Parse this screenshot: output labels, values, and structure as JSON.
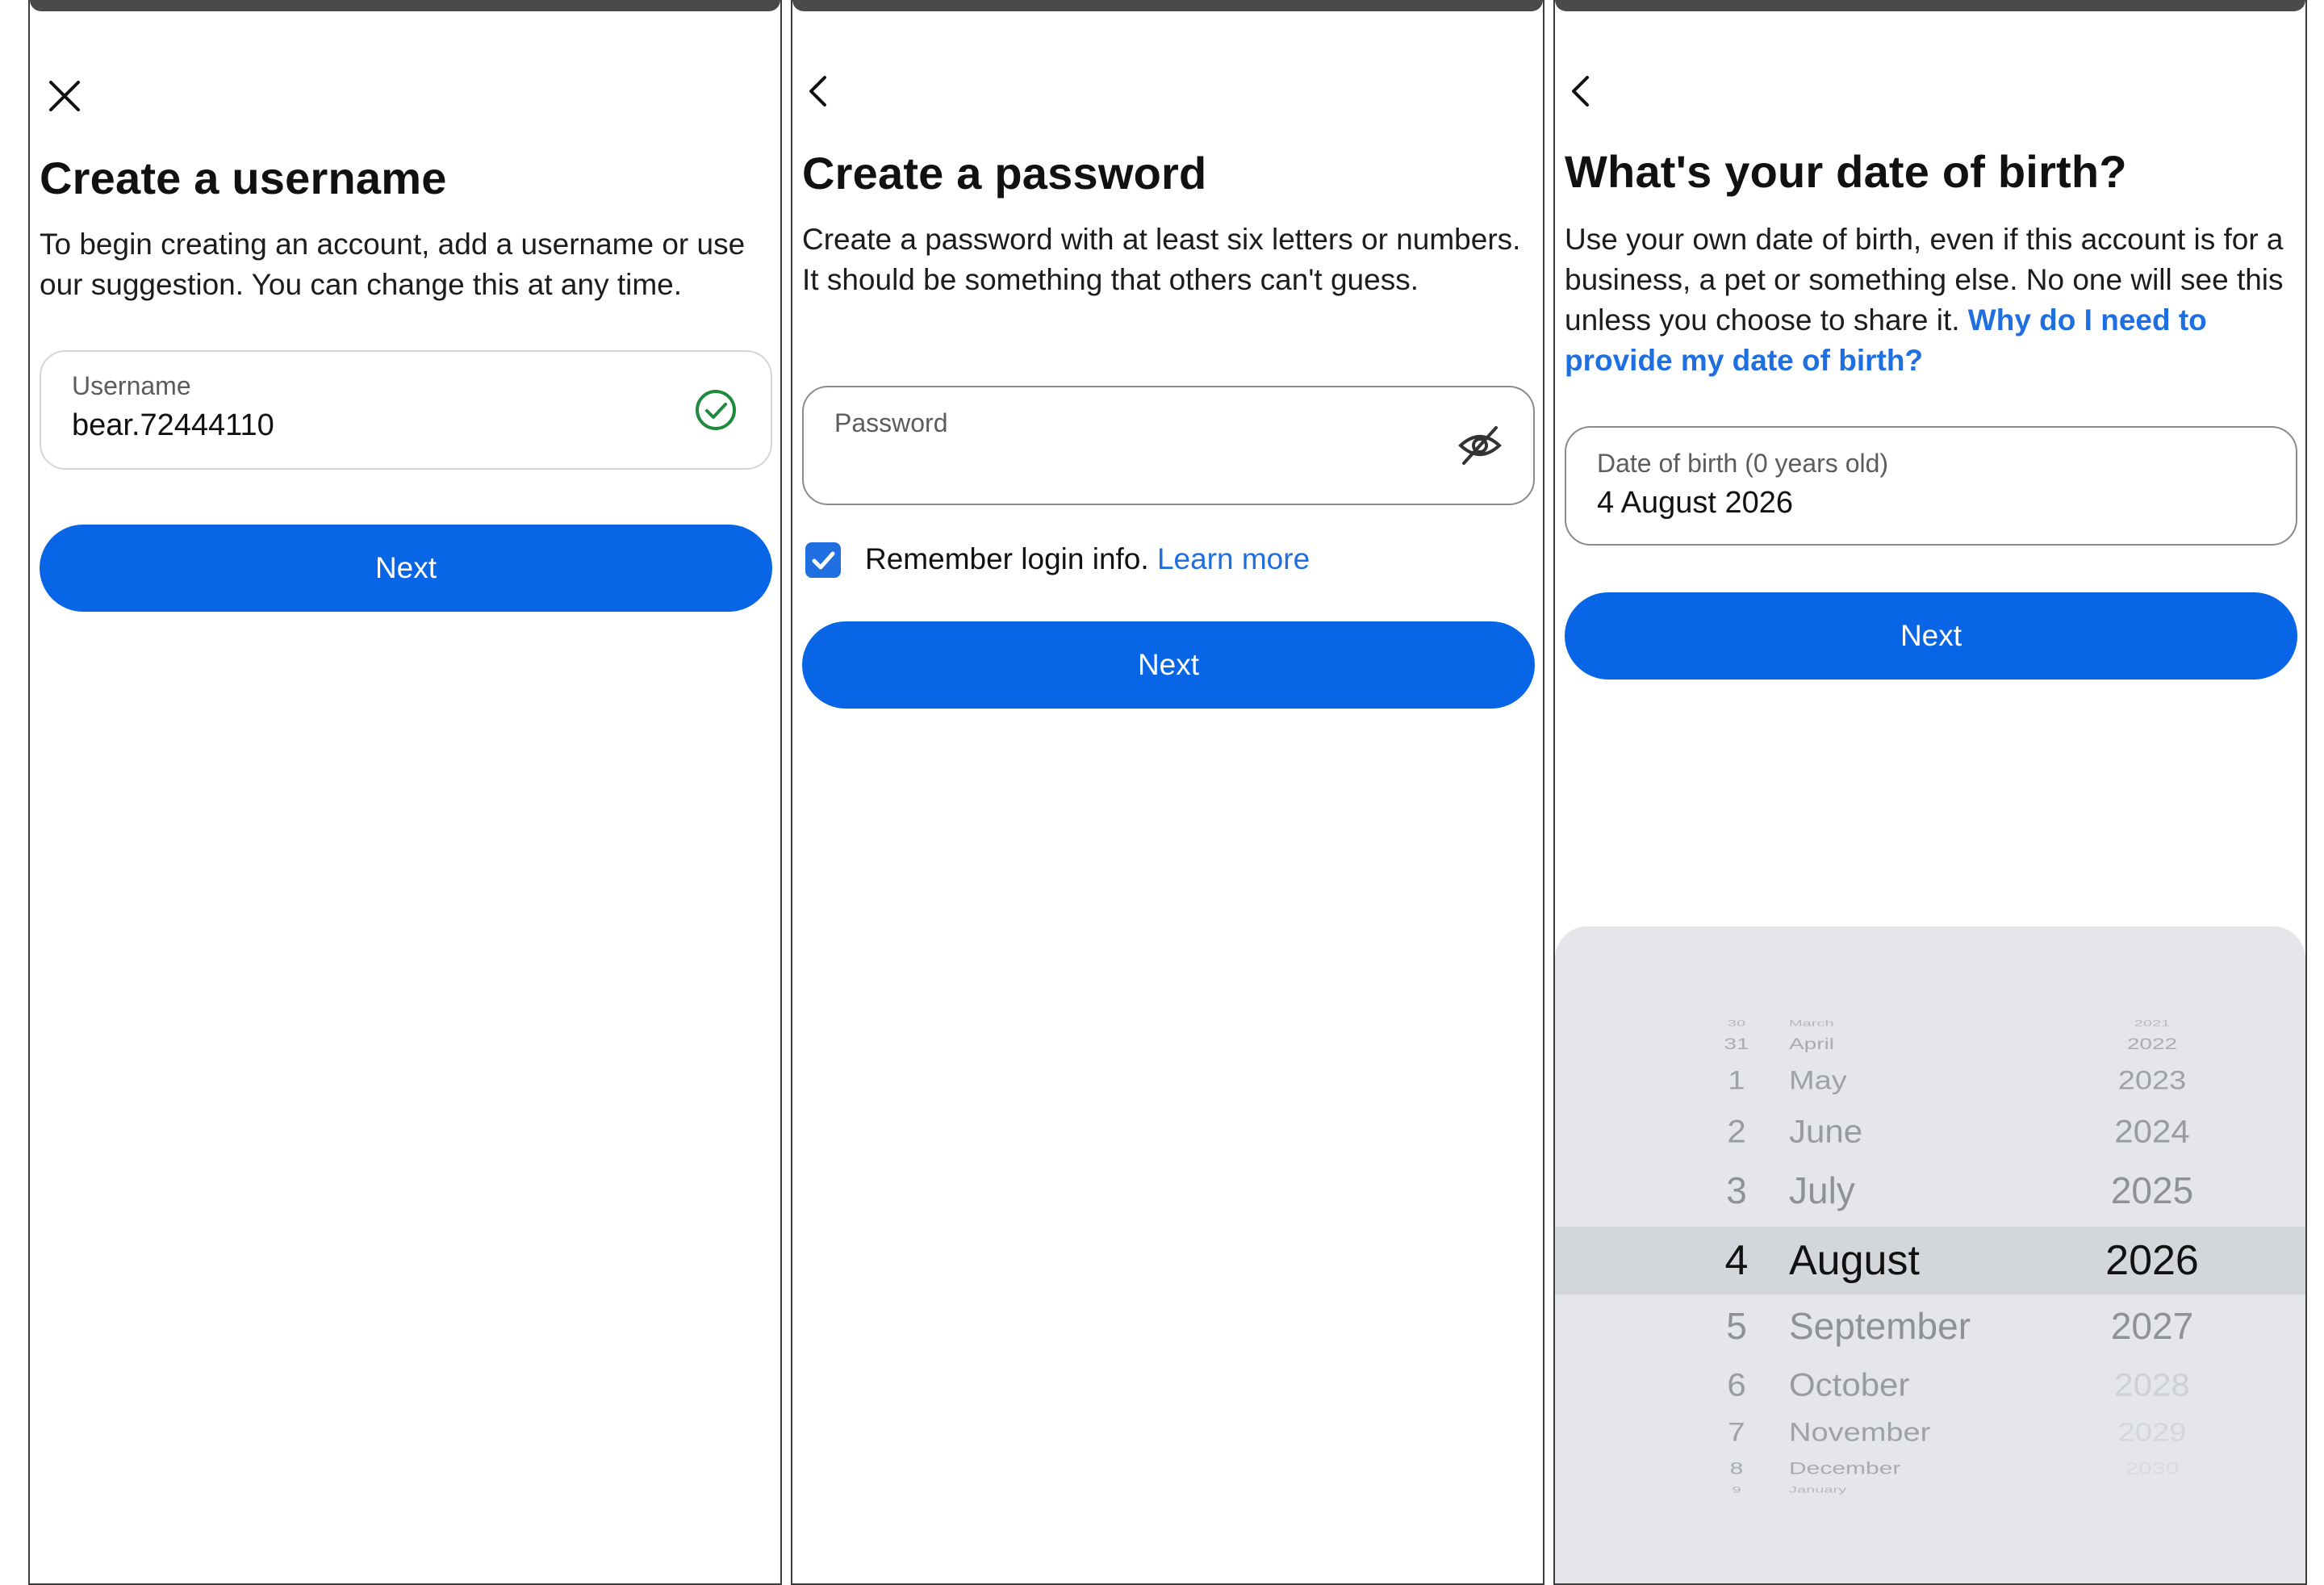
{
  "screen1": {
    "close_icon": "close-icon",
    "title": "Create a username",
    "description": "To begin creating an account, add a username or use our suggestion. You can change this at any time.",
    "username_label": "Username",
    "username_value": "bear.72444110",
    "valid_icon": "check-circle-icon",
    "next_label": "Next"
  },
  "screen2": {
    "back_icon": "chevron-left-icon",
    "title": "Create a password",
    "description": "Create a password with at least six letters or numbers. It should be something that others can't guess.",
    "password_placeholder": "Password",
    "visibility_icon": "eye-off-icon",
    "remember_checked": true,
    "remember_label": "Remember login info.",
    "learn_more": "Learn more",
    "next_label": "Next"
  },
  "screen3": {
    "back_icon": "chevron-left-icon",
    "title": "What's your date of birth?",
    "description": "Use your own date of birth, even if this account is for a business, a pet or something else. No one will see this unless you choose to share it.",
    "why_link": "Why do I need to provide my date of birth?",
    "dob_label": "Date of birth (0 years old)",
    "dob_value": "4 August 2026",
    "next_label": "Next",
    "picker": {
      "days": [
        "30",
        "31",
        "1",
        "2",
        "3",
        "4",
        "5",
        "6",
        "7",
        "8",
        "9"
      ],
      "months": [
        "March",
        "April",
        "May",
        "June",
        "July",
        "August",
        "September",
        "October",
        "November",
        "December",
        "January"
      ],
      "years": [
        "2021",
        "2022",
        "2023",
        "2024",
        "2025",
        "2026",
        "2027",
        "2028",
        "2029",
        "2030",
        ""
      ]
    }
  },
  "colors": {
    "primary": "#0866e6",
    "link": "#1f6fe0",
    "valid": "#1e8a3c",
    "picker_bg": "#e4e6ea"
  }
}
